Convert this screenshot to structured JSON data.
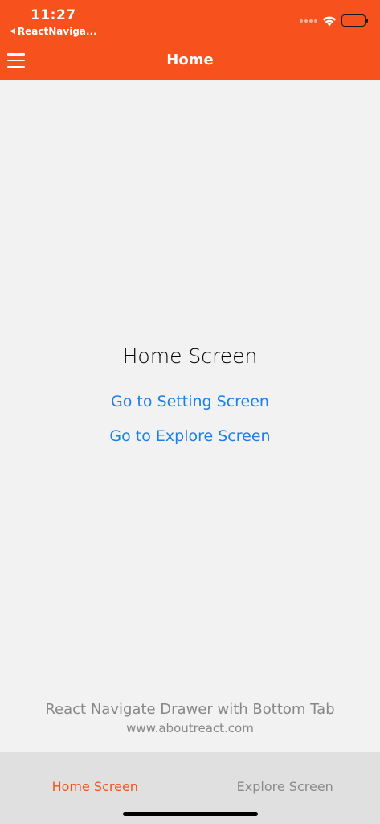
{
  "status_bar": {
    "time": "11:27",
    "back_app": "ReactNaviga...",
    "back_glyph": "◀",
    "battery_level": 0.0
  },
  "header": {
    "title": "Home",
    "menu_icon": "hamburger-menu-icon"
  },
  "main": {
    "title": "Home Screen",
    "links": {
      "setting": "Go to Setting Screen",
      "explore": "Go to Explore Screen"
    }
  },
  "footer": {
    "caption": "React Navigate Drawer with Bottom Tab",
    "website": "www.aboutreact.com"
  },
  "tabbar": {
    "tabs": [
      {
        "label": "Home Screen",
        "active": true
      },
      {
        "label": "Explore Screen",
        "active": false
      }
    ]
  },
  "colors": {
    "accent": "#f7511e",
    "link": "#1b7fe8",
    "background": "#f2f2f2",
    "tabbar_bg": "#e0e0e0",
    "muted_text": "#888888"
  }
}
